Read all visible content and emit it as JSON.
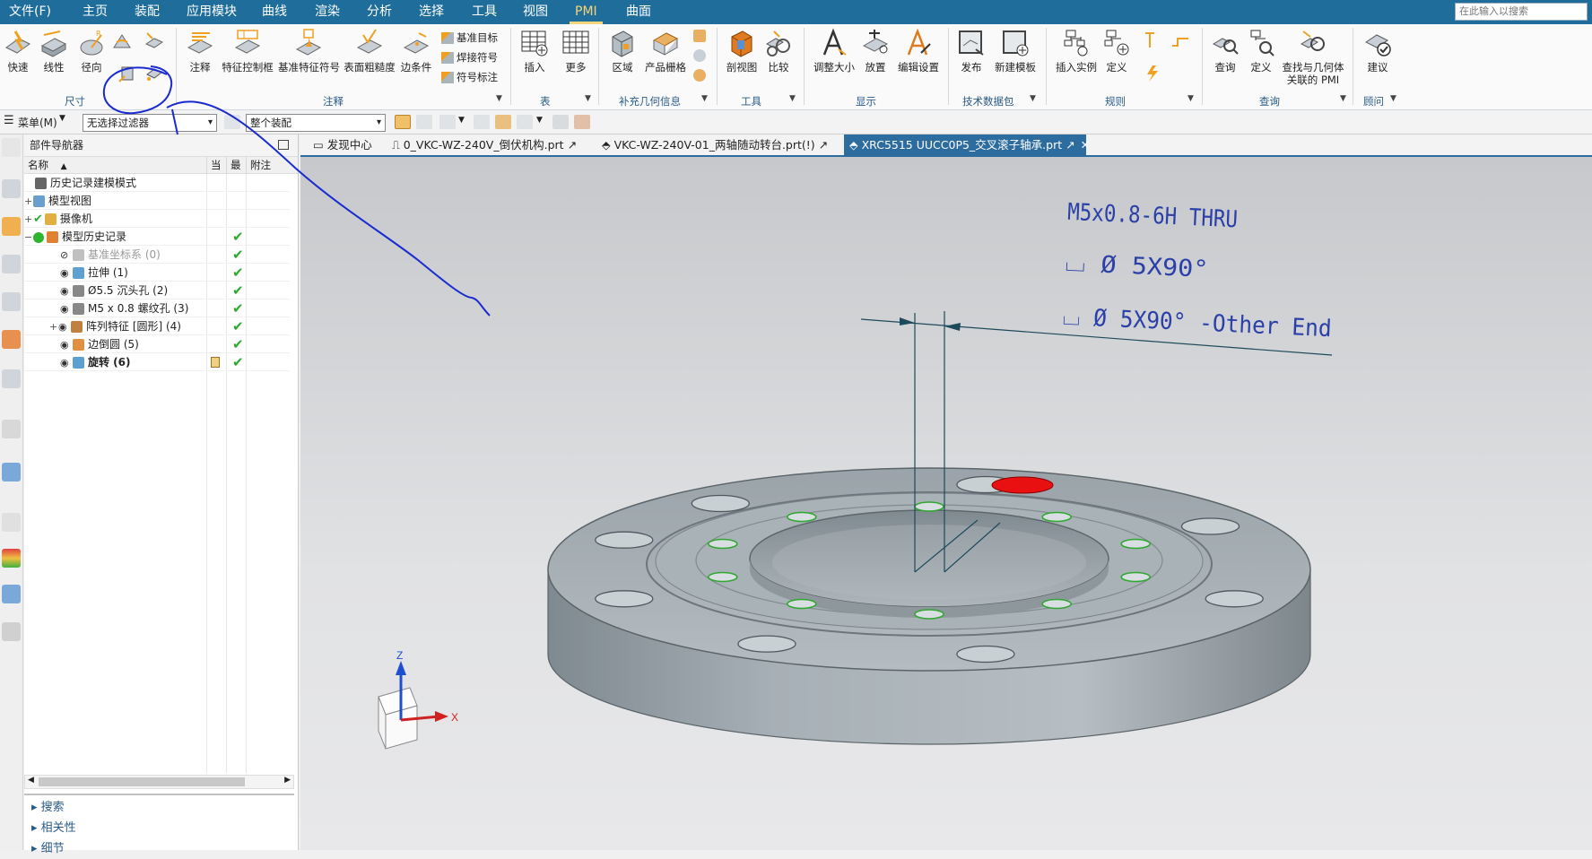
{
  "menubar": {
    "items": [
      "文件(F)",
      "主页",
      "装配",
      "应用模块",
      "曲线",
      "渲染",
      "分析",
      "选择",
      "工具",
      "视图",
      "PMI",
      "曲面"
    ],
    "active": "PMI",
    "search_placeholder": "在此输入以搜索"
  },
  "ribbon": {
    "dim": [
      "快速",
      "线性",
      "径向"
    ],
    "ann": [
      "注释",
      "特征控制框",
      "基准特征符号",
      "表面粗糙度",
      "边条件"
    ],
    "ann_small": [
      "基准目标",
      "焊接符号",
      "符号标注"
    ],
    "table": [
      "插入",
      "更多"
    ],
    "supp": [
      "区域",
      "产品栅格"
    ],
    "tools": [
      "剖视图",
      "比较"
    ],
    "disp": [
      "调整大小",
      "放置",
      "编辑设置"
    ],
    "tdp": [
      "发布",
      "新建模板"
    ],
    "rules": [
      "插入实例",
      "定义"
    ],
    "query": [
      "查询",
      "定义"
    ],
    "query_multi": [
      "查找与几何体",
      "关联的 PMI"
    ],
    "advisor": [
      "建议"
    ],
    "groups": [
      "尺寸",
      "注释",
      "表",
      "补充几何信息",
      "工具",
      "显示",
      "技术数据包",
      "规则",
      "查询",
      "顾问"
    ]
  },
  "toolbar2": {
    "menu": "菜单(M)",
    "filter": "无选择过滤器",
    "scope": "整个装配"
  },
  "navigator": {
    "title": "部件导航器",
    "columns": [
      "名称",
      "当",
      "最",
      "附注"
    ],
    "rows": [
      {
        "label": "历史记录建模模式",
        "check": false,
        "dim": false,
        "bold": false
      },
      {
        "label": "模型视图",
        "check": false,
        "dim": false,
        "bold": false
      },
      {
        "label": "摄像机",
        "check": false,
        "dim": false,
        "bold": false
      },
      {
        "label": "模型历史记录",
        "check": true,
        "dim": false,
        "bold": false
      },
      {
        "label": "基准坐标系 (0)",
        "check": true,
        "dim": true,
        "bold": false
      },
      {
        "label": "拉伸 (1)",
        "check": true,
        "dim": false,
        "bold": false
      },
      {
        "label": "Ø5.5 沉头孔 (2)",
        "check": true,
        "dim": false,
        "bold": false
      },
      {
        "label": "M5 x 0.8 螺纹孔 (3)",
        "check": true,
        "dim": false,
        "bold": false
      },
      {
        "label": "阵列特征 [圆形] (4)",
        "check": true,
        "dim": false,
        "bold": false
      },
      {
        "label": "边倒圆 (5)",
        "check": true,
        "dim": false,
        "bold": false
      },
      {
        "label": "旋转 (6)",
        "check": true,
        "dim": false,
        "bold": true
      }
    ],
    "panels": [
      "搜索",
      "相关性",
      "细节"
    ]
  },
  "tabs": [
    {
      "label": "发现中心",
      "active": false
    },
    {
      "label": "0_VKC-WZ-240V_倒伏机构.prt",
      "active": false
    },
    {
      "label": "VKC-WZ-240V-01_两轴随动转台.prt(!)",
      "active": false
    },
    {
      "label": "XRC5515 UUCC0P5_交叉滚子轴承.prt",
      "active": true
    }
  ],
  "pmi": {
    "line1": "M5x0.8-6H THRU",
    "line2": "⌴ Ø 5X90°",
    "line3": "⌴ Ø 5X90° -Other End"
  },
  "axes": {
    "z": "Z",
    "x": "X"
  },
  "colors": {
    "menubar": "#1f6d9a",
    "active_tab": "#2d6c9f",
    "part": "#9aa4ab",
    "highlight": "#e81010",
    "pmi": "#2b3fa8",
    "markup": "#1a2bd0"
  }
}
